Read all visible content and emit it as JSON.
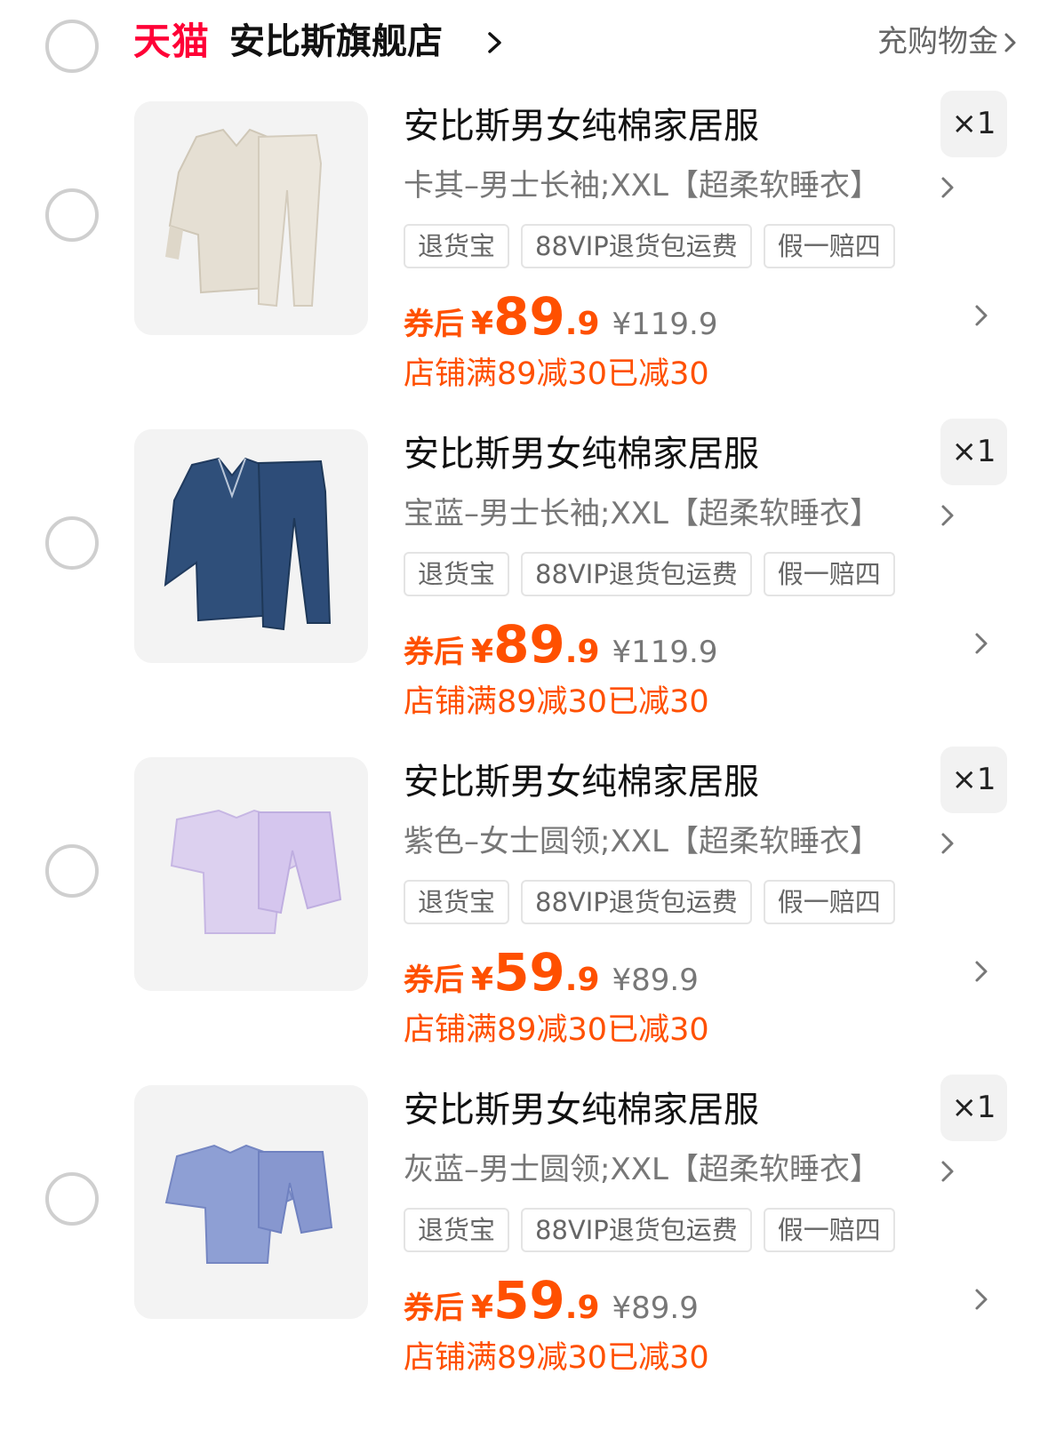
{
  "store": {
    "logo_text": "天猫",
    "name": "安比斯旗舰店",
    "buy_credit_label": "充购物金",
    "brand_color": "#ff0036"
  },
  "colors": {
    "price_accent": "#ff5000",
    "muted_text": "#777777",
    "tag_border": "#e4e4e4"
  },
  "items": [
    {
      "title": "安比斯男女纯棉家居服",
      "sku": "卡其–男士长袖;XXL【超柔软睡衣】",
      "quantity": "×1",
      "tags": [
        "退货宝",
        "88VIP退货包运费",
        "假一赔四"
      ],
      "coupon_label": "券后",
      "currency": "¥",
      "price_int": "89",
      "price_dec": ".9",
      "original_price": "¥119.9",
      "promo": "店铺满89减30已减30",
      "image_icon": "khaki-long-sleeve-pajama-set"
    },
    {
      "title": "安比斯男女纯棉家居服",
      "sku": "宝蓝–男士长袖;XXL【超柔软睡衣】",
      "quantity": "×1",
      "tags": [
        "退货宝",
        "88VIP退货包运费",
        "假一赔四"
      ],
      "coupon_label": "券后",
      "currency": "¥",
      "price_int": "89",
      "price_dec": ".9",
      "original_price": "¥119.9",
      "promo": "店铺满89减30已减30",
      "image_icon": "navy-long-sleeve-pajama-set"
    },
    {
      "title": "安比斯男女纯棉家居服",
      "sku": "紫色–女士圆领;XXL【超柔软睡衣】",
      "quantity": "×1",
      "tags": [
        "退货宝",
        "88VIP退货包运费",
        "假一赔四"
      ],
      "coupon_label": "券后",
      "currency": "¥",
      "price_int": "59",
      "price_dec": ".9",
      "original_price": "¥89.9",
      "promo": "店铺满89减30已减30",
      "image_icon": "purple-short-sleeve-pajama-set"
    },
    {
      "title": "安比斯男女纯棉家居服",
      "sku": "灰蓝–男士圆领;XXL【超柔软睡衣】",
      "quantity": "×1",
      "tags": [
        "退货宝",
        "88VIP退货包运费",
        "假一赔四"
      ],
      "coupon_label": "券后",
      "currency": "¥",
      "price_int": "59",
      "price_dec": ".9",
      "original_price": "¥89.9",
      "promo": "店铺满89减30已减30",
      "image_icon": "grey-blue-short-sleeve-pajama-set"
    }
  ]
}
